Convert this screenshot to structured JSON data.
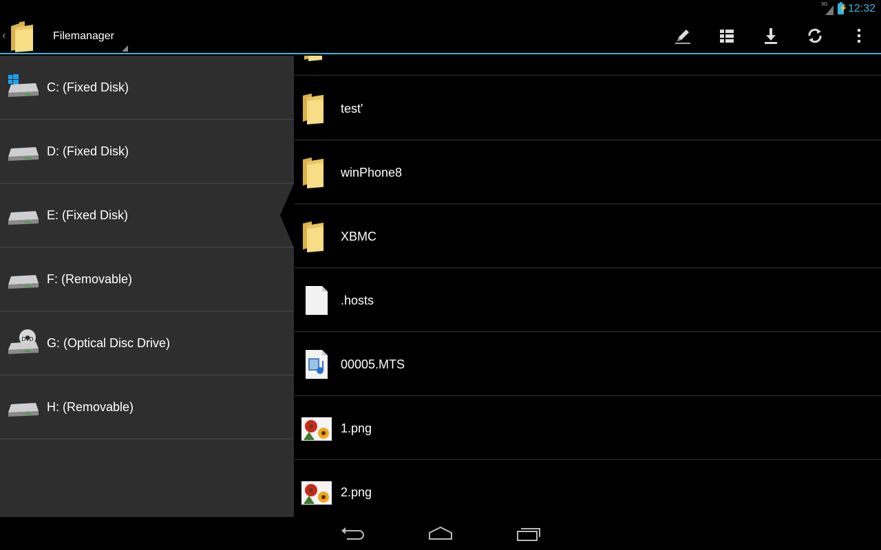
{
  "status_bar": {
    "network": "3G",
    "time": "12:32"
  },
  "action_bar": {
    "title": "Filemanager",
    "actions": [
      {
        "icon": "pencil-icon",
        "name": "edit-button"
      },
      {
        "icon": "list-view-icon",
        "name": "view-mode-button"
      },
      {
        "icon": "download-icon",
        "name": "download-button"
      },
      {
        "icon": "refresh-icon",
        "name": "refresh-button"
      },
      {
        "icon": "overflow-menu-icon",
        "name": "overflow-menu-button"
      }
    ]
  },
  "drives": [
    {
      "label": "C: (Fixed Disk)",
      "icon": "windows-drive-icon"
    },
    {
      "label": "D: (Fixed Disk)",
      "icon": "hard-drive-icon"
    },
    {
      "label": "E: (Fixed Disk)",
      "icon": "hard-drive-icon",
      "selected": true
    },
    {
      "label": "F: (Removable)",
      "icon": "hard-drive-icon"
    },
    {
      "label": "G: (Optical Disc Drive)",
      "icon": "dvd-drive-icon",
      "badge": "DVD"
    },
    {
      "label": "H: (Removable)",
      "icon": "hard-drive-icon"
    }
  ],
  "files": [
    {
      "name": "test'",
      "icon": "folder-icon"
    },
    {
      "name": "winPhone8",
      "icon": "folder-icon"
    },
    {
      "name": "XBMC",
      "icon": "folder-icon"
    },
    {
      "name": ".hosts",
      "icon": "file-icon"
    },
    {
      "name": "00005.MTS",
      "icon": "media-file-icon"
    },
    {
      "name": "1.png",
      "icon": "image-icon"
    },
    {
      "name": "2.png",
      "icon": "image-icon"
    }
  ],
  "colors": {
    "accent": "#33b5e5",
    "drive_panel": "#2e2e2e",
    "folder": "#f2d574"
  }
}
